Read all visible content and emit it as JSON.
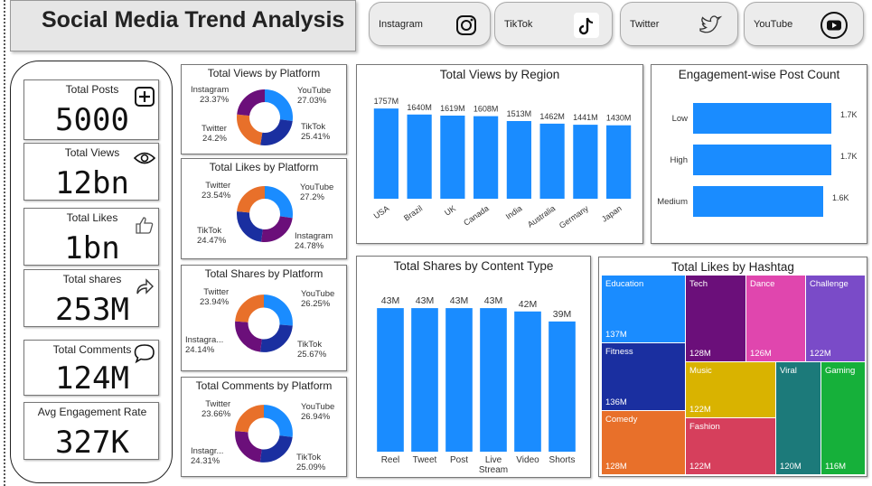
{
  "title": "Social Media Trend Analysis",
  "platforms": [
    {
      "label": "Instagram",
      "icon": "instagram-icon"
    },
    {
      "label": "TikTok",
      "icon": "tiktok-icon"
    },
    {
      "label": "Twitter",
      "icon": "twitter-icon"
    },
    {
      "label": "YouTube",
      "icon": "youtube-icon"
    }
  ],
  "kpis": {
    "posts": {
      "title": "Total Posts",
      "value": "5000",
      "icon": "plus-box-icon"
    },
    "views": {
      "title": "Total Views",
      "value": "12bn",
      "icon": "eye-icon"
    },
    "likes": {
      "title": "Total Likes",
      "value": "1bn",
      "icon": "thumbs-up-icon"
    },
    "shares": {
      "title": "Total shares",
      "value": "253M",
      "icon": "share-arrow-icon"
    },
    "comments": {
      "title": "Total Comments",
      "value": "124M",
      "icon": "comment-bubble-icon"
    },
    "engagement": {
      "title": "Avg Engagement Rate",
      "value": "327K"
    }
  },
  "colors": {
    "blue": "#1a8cff",
    "youtube": "#1a8cff",
    "tiktok": "#1a2fa0",
    "instagram": "#6b0f7a",
    "twitter": "#e8702a"
  },
  "chart_data": [
    {
      "type": "pie",
      "title": "Total Views by Platform",
      "slices": [
        {
          "name": "YouTube",
          "value": 27.03,
          "label": "27.03%"
        },
        {
          "name": "TikTok",
          "value": 25.41,
          "label": "25.41%"
        },
        {
          "name": "Twitter",
          "value": 24.2,
          "label": "24.2%"
        },
        {
          "name": "Instagram",
          "value": 23.37,
          "label": "23.37%"
        }
      ]
    },
    {
      "type": "pie",
      "title": "Total Likes by Platform",
      "slices": [
        {
          "name": "YouTube",
          "value": 27.2,
          "label": "27.2%"
        },
        {
          "name": "Instagram",
          "value": 24.78,
          "label": "24.78%"
        },
        {
          "name": "TikTok",
          "value": 24.47,
          "label": "24.47%"
        },
        {
          "name": "Twitter",
          "value": 23.54,
          "label": "23.54%"
        }
      ]
    },
    {
      "type": "pie",
      "title": "Total Shares by Platform",
      "slices": [
        {
          "name": "YouTube",
          "value": 26.25,
          "label": "26.25%"
        },
        {
          "name": "TikTok",
          "value": 25.67,
          "label": "25.67%"
        },
        {
          "name": "Instagra...",
          "value": 24.14,
          "label": "24.14%"
        },
        {
          "name": "Twitter",
          "value": 23.94,
          "label": "23.94%"
        }
      ]
    },
    {
      "type": "pie",
      "title": "Total Comments by Platform",
      "slices": [
        {
          "name": "YouTube",
          "value": 26.94,
          "label": "26.94%"
        },
        {
          "name": "TikTok",
          "value": 25.09,
          "label": "25.09%"
        },
        {
          "name": "Instagr...",
          "value": 24.31,
          "label": "24.31%"
        },
        {
          "name": "Twitter",
          "value": 23.66,
          "label": "23.66%"
        }
      ]
    },
    {
      "type": "bar",
      "title": "Total Views by Region",
      "categories": [
        "USA",
        "Brazil",
        "UK",
        "Canada",
        "India",
        "Australia",
        "Germany",
        "Japan"
      ],
      "values": [
        1757,
        1640,
        1619,
        1608,
        1513,
        1462,
        1441,
        1430
      ],
      "labels": [
        "1757M",
        "1640M",
        "1619M",
        "1608M",
        "1513M",
        "1462M",
        "1441M",
        "1430M"
      ],
      "ylim": [
        0,
        1900
      ]
    },
    {
      "type": "bar",
      "orientation": "horizontal",
      "title": "Engagement-wise Post Count",
      "categories": [
        "Low",
        "High",
        "Medium"
      ],
      "values": [
        1.7,
        1.7,
        1.6
      ],
      "labels": [
        "1.7K",
        "1.7K",
        "1.6K"
      ],
      "xlim": [
        0,
        1.8
      ]
    },
    {
      "type": "bar",
      "title": "Total Shares by Content Type",
      "categories": [
        "Reel",
        "Tweet",
        "Post",
        "Live Stream",
        "Video",
        "Shorts"
      ],
      "values": [
        43,
        43,
        43,
        43,
        42,
        39
      ],
      "labels": [
        "43M",
        "43M",
        "43M",
        "43M",
        "42M",
        "39M"
      ],
      "ylim": [
        0,
        46
      ]
    },
    {
      "type": "heatmap",
      "title": "Total Likes by Hashtag",
      "cells": [
        {
          "name": "Education",
          "value": "137M",
          "color": "#1a8cff"
        },
        {
          "name": "Tech",
          "value": "128M",
          "color": "#6b0f7a"
        },
        {
          "name": "Dance",
          "value": "126M",
          "color": "#e046ae"
        },
        {
          "name": "Challenge",
          "value": "122M",
          "color": "#7a4bc8"
        },
        {
          "name": "Fitness",
          "value": "136M",
          "color": "#1a2fa0"
        },
        {
          "name": "Music",
          "value": "122M",
          "color": "#d9b300"
        },
        {
          "name": "Viral",
          "value": "120M",
          "color": "#1c7a7a"
        },
        {
          "name": "Gaming",
          "value": "116M",
          "color": "#16b03a"
        },
        {
          "name": "Comedy",
          "value": "128M",
          "color": "#e8702a"
        },
        {
          "name": "Fashion",
          "value": "122M",
          "color": "#d63f5c"
        }
      ]
    }
  ]
}
